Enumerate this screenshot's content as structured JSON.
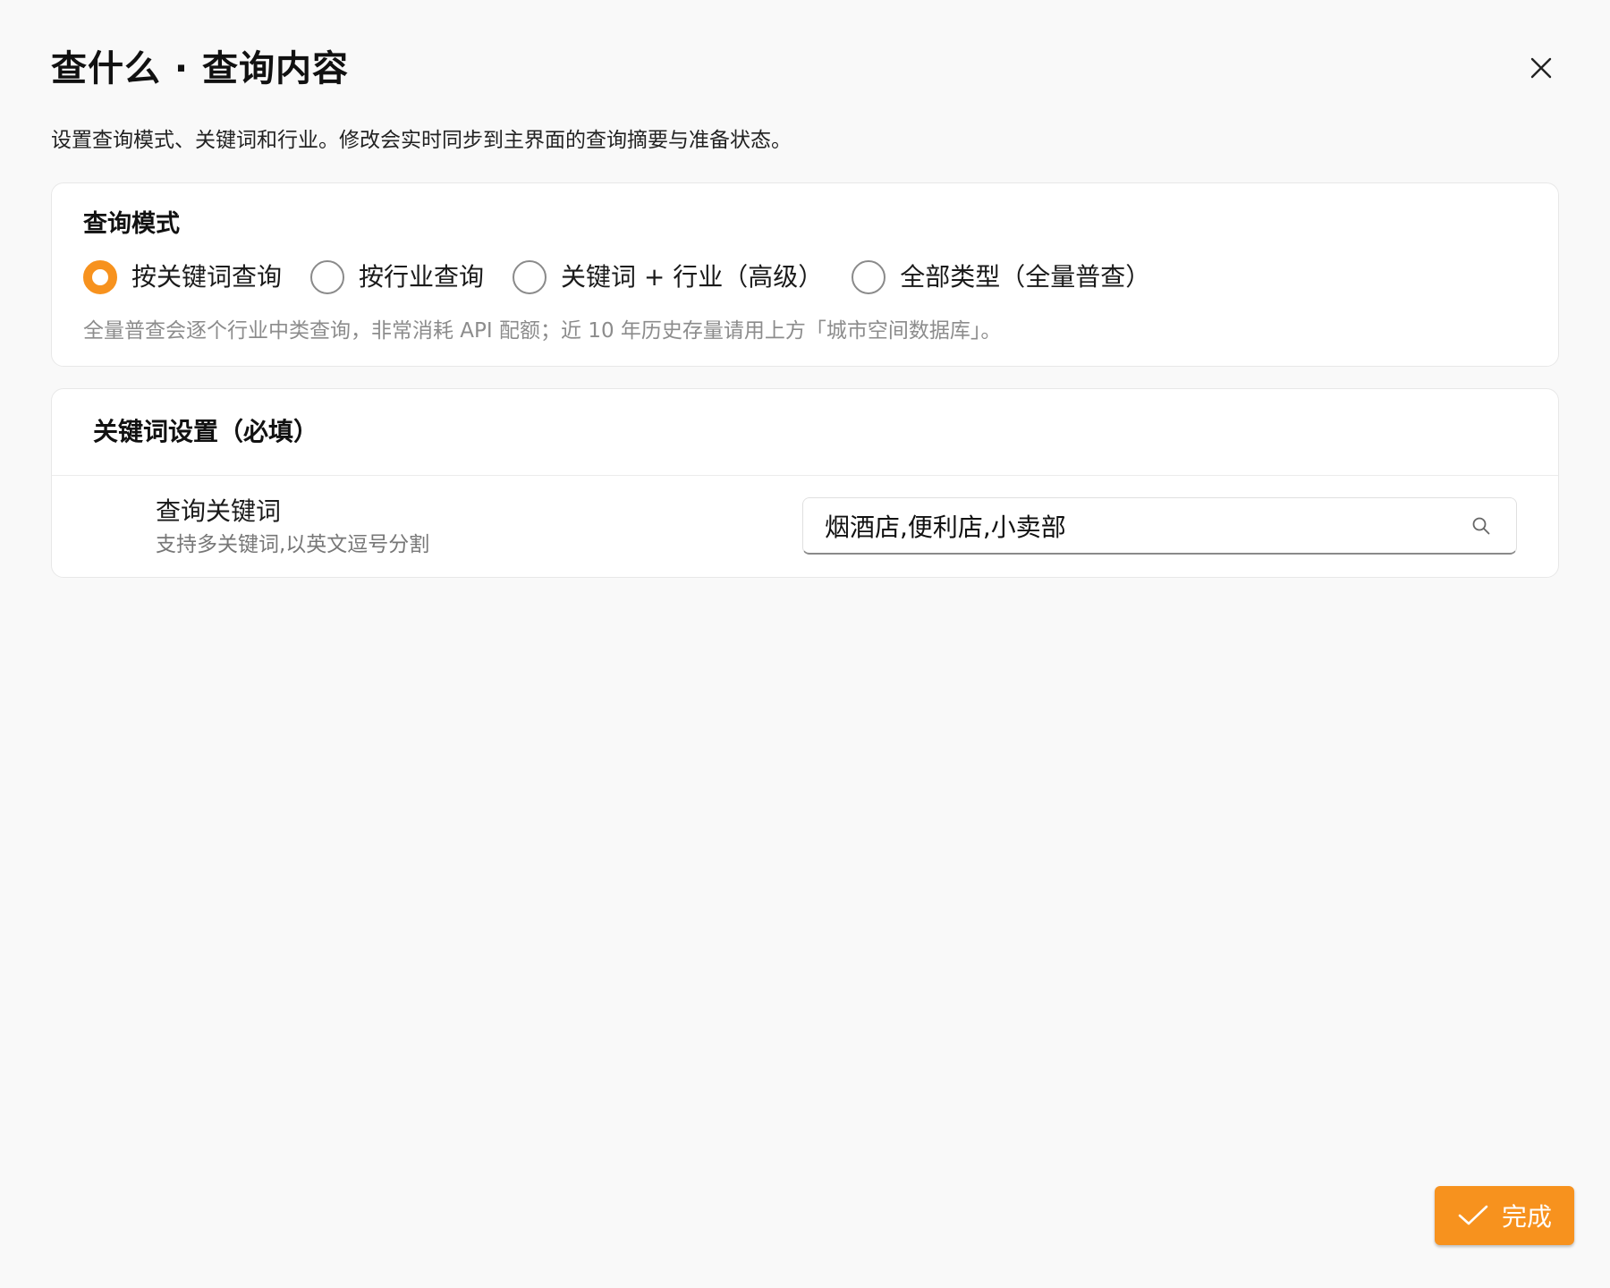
{
  "dialog": {
    "title": "查什么 · 查询内容",
    "description": "设置查询模式、关键词和行业。修改会实时同步到主界面的查询摘要与准备状态。"
  },
  "query_mode": {
    "title": "查询模式",
    "options": [
      {
        "label": "按关键词查询",
        "selected": true
      },
      {
        "label": "按行业查询",
        "selected": false
      },
      {
        "label": "关键词 + 行业（高级）",
        "selected": false
      },
      {
        "label": "全部类型（全量普查）",
        "selected": false
      }
    ],
    "hint": "全量普查会逐个行业中类查询，非常消耗 API 配额；近 10 年历史存量请用上方「城市空间数据库」。"
  },
  "keyword_settings": {
    "title": "关键词设置（必填）",
    "field_label": "查询关键词",
    "field_sublabel": "支持多关键词,以英文逗号分割",
    "value": "烟酒店,便利店,小卖部"
  },
  "footer": {
    "done_label": "完成"
  },
  "colors": {
    "accent": "#f7921e",
    "background": "#f9f9f9"
  },
  "icons": {
    "close": "close-icon",
    "search": "search-icon",
    "check": "check-icon"
  }
}
